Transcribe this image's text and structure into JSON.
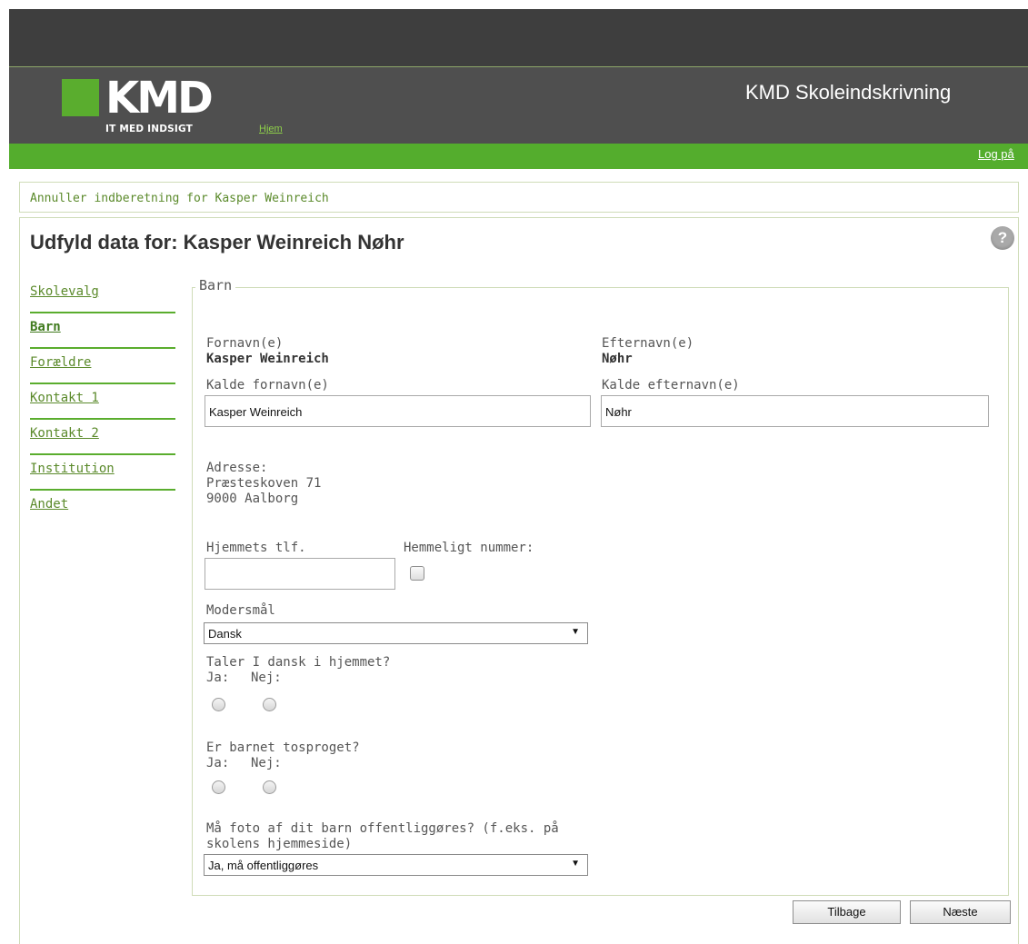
{
  "header": {
    "logo_text": "KMD",
    "logo_tagline": "IT MED INDSIGT",
    "home_link": "Hjem",
    "app_title": "KMD Skoleindskrivning",
    "login_link": "Log på"
  },
  "cancel_link": "Annuller indberetning for Kasper Weinreich",
  "page_title": "Udfyld data for: Kasper Weinreich Nøhr",
  "help_icon_glyph": "?",
  "nav": {
    "items": [
      {
        "label": "Skolevalg",
        "active": false
      },
      {
        "label": "Barn",
        "active": true
      },
      {
        "label": "Forældre",
        "active": false
      },
      {
        "label": "Kontakt 1",
        "active": false
      },
      {
        "label": "Kontakt 2",
        "active": false
      },
      {
        "label": "Institution",
        "active": false
      },
      {
        "label": "Andet",
        "active": false
      }
    ]
  },
  "form": {
    "legend": "Barn",
    "first_name_label": "Fornavn(e)",
    "first_name_value": "Kasper Weinreich",
    "last_name_label": "Efternavn(e)",
    "last_name_value": "Nøhr",
    "call_first_name_label": "Kalde fornavn(e)",
    "call_first_name_value": "Kasper Weinreich",
    "call_last_name_label": "Kalde efternavn(e)",
    "call_last_name_value": "Nøhr",
    "address_label": "Adresse:",
    "address_street": "Præsteskoven 71",
    "address_city": "9000  Aalborg",
    "home_phone_label": "Hjemmets tlf.",
    "home_phone_value": "",
    "secret_number_label": "Hemmeligt nummer:",
    "secret_number_checked": false,
    "mother_tongue_label": "Modersmål",
    "mother_tongue_value": "Dansk",
    "danish_at_home_label": "Taler I dansk i hjemmet?",
    "danish_at_home_yes": "Ja:",
    "danish_at_home_no": "Nej:",
    "bilingual_label": "Er barnet tosproget?",
    "bilingual_yes": "Ja:",
    "bilingual_no": "Nej:",
    "photo_label_line1": "Må foto af dit barn offentliggøres? (f.eks. på",
    "photo_label_line2": "skolens hjemmeside)",
    "photo_value": "Ja, må offentliggøres",
    "select_arrow": "▼"
  },
  "buttons": {
    "back": "Tilbage",
    "next": "Næste"
  },
  "colors": {
    "header_dark": "#3e3e3e",
    "header": "#4f4f4f",
    "brand_green": "#54ad2d",
    "link_green": "#5b8a2b"
  }
}
